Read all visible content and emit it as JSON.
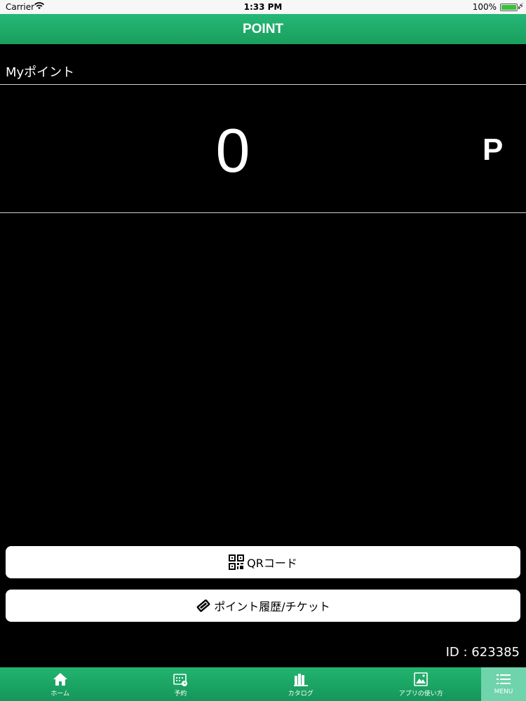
{
  "status_bar": {
    "carrier": "Carrier",
    "time": "1:33 PM",
    "battery": "100%"
  },
  "header": {
    "title": "POINT"
  },
  "points": {
    "section_title": "Myポイント",
    "value": "0",
    "unit": "P"
  },
  "buttons": {
    "qr_label": "QRコード",
    "history_label": "ポイント履歴/チケット"
  },
  "user": {
    "id_text": "ID : 623385"
  },
  "tabs": [
    {
      "label": "ホーム",
      "icon": "home-icon"
    },
    {
      "label": "予約",
      "icon": "calendar-icon"
    },
    {
      "label": "カタログ",
      "icon": "catalog-icon"
    },
    {
      "label": "アプリの使い方",
      "icon": "image-icon"
    },
    {
      "label": "MENU",
      "icon": "menu-icon"
    }
  ],
  "colors": {
    "brand_green": "#1fa866",
    "menu_highlight": "#6fd3ac",
    "background": "#000000"
  }
}
